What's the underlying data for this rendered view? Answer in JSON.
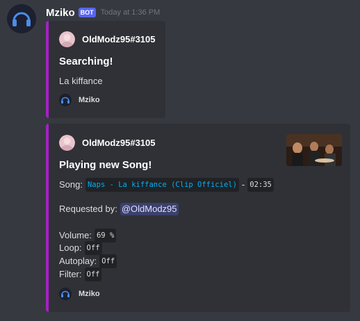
{
  "message": {
    "author": "Mziko",
    "bot_tag": "BOT",
    "timestamp": "Today at 1:36 PM",
    "avatar_icon": "headphones-icon"
  },
  "colors": {
    "background": "#36393f",
    "embed_bg": "#2f3136",
    "embed_accent": "#a620c4",
    "bot_tag": "#5865f2",
    "link": "#00b0f4",
    "mention_bg": "#4e5996"
  },
  "embeds": [
    {
      "author": "OldModz95#3105",
      "title": "Searching!",
      "description": "La kiffance",
      "footer": "Mziko",
      "footer_icon": "headphones-icon"
    },
    {
      "author": "OldModz95#3105",
      "title": "Playing new Song!",
      "thumbnail": "video-thumbnail-image",
      "song_label": "Song:",
      "song_title": "Naps - La kiffance (Clip Officiel)",
      "song_separator": "-",
      "duration": "02:35",
      "requested_label": "Requested by:",
      "requested_by": "@OldModz95",
      "volume_label": "Volume:",
      "volume_value": "69 %",
      "loop_label": "Loop:",
      "loop_value": "Off",
      "autoplay_label": "Autoplay:",
      "autoplay_value": "Off",
      "filter_label": "Filter:",
      "filter_value": "Off",
      "footer": "Mziko",
      "footer_icon": "headphones-icon"
    }
  ]
}
